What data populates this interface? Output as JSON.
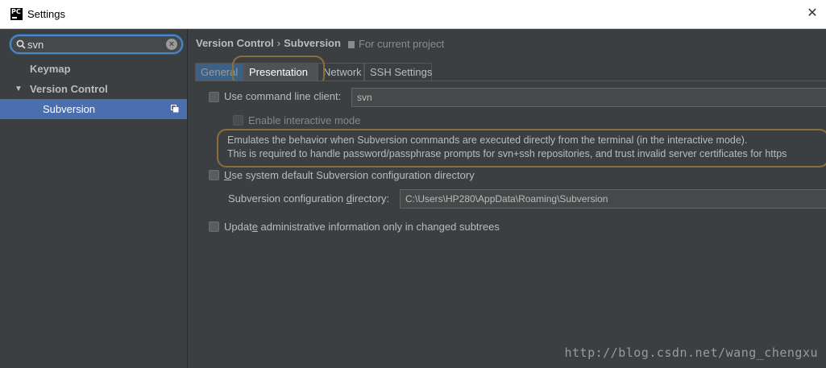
{
  "window": {
    "title": "Settings",
    "app_icon": "PC"
  },
  "search": {
    "value": "svn"
  },
  "sidebar": {
    "items": [
      {
        "label": "Keymap"
      },
      {
        "label": "Version Control"
      },
      {
        "label": "Subversion"
      }
    ]
  },
  "header": {
    "crumb_parent": "Version Control",
    "crumb_sep": "›",
    "crumb_current": "Subversion",
    "scope": "For current project"
  },
  "tabs": [
    {
      "label": "General"
    },
    {
      "label": "Presentation"
    },
    {
      "label": "Network"
    },
    {
      "label": "SSH Settings"
    }
  ],
  "general": {
    "use_cmd_label": "Use command line client:",
    "cmd_value": "svn",
    "interactive_label": "Enable interactive mode",
    "desc_line1": "Emulates the behavior when Subversion commands are executed directly from the terminal (in the interactive mode).",
    "desc_line2": "This is required to handle password/passphrase prompts for svn+ssh repositories, and trust invalid server certificates for https",
    "sysdefault_label_u": "U",
    "sysdefault_label_rest": "se system default Subversion configuration directory",
    "config_dir_label_a": "Subversion configuration ",
    "config_dir_label_u": "d",
    "config_dir_label_b": "irectory:",
    "config_dir_value": "C:\\Users\\HP280\\AppData\\Roaming\\Subversion",
    "update_label_a": "Updat",
    "update_label_u": "e",
    "update_label_b": " administrative information only in changed subtrees"
  },
  "watermark": "http://blog.csdn.net/wang_chengxu",
  "colors": {
    "accent": "#4b6eaf",
    "highlight_ring": "#8b6f3a",
    "search_focus": "#4a88c7"
  }
}
